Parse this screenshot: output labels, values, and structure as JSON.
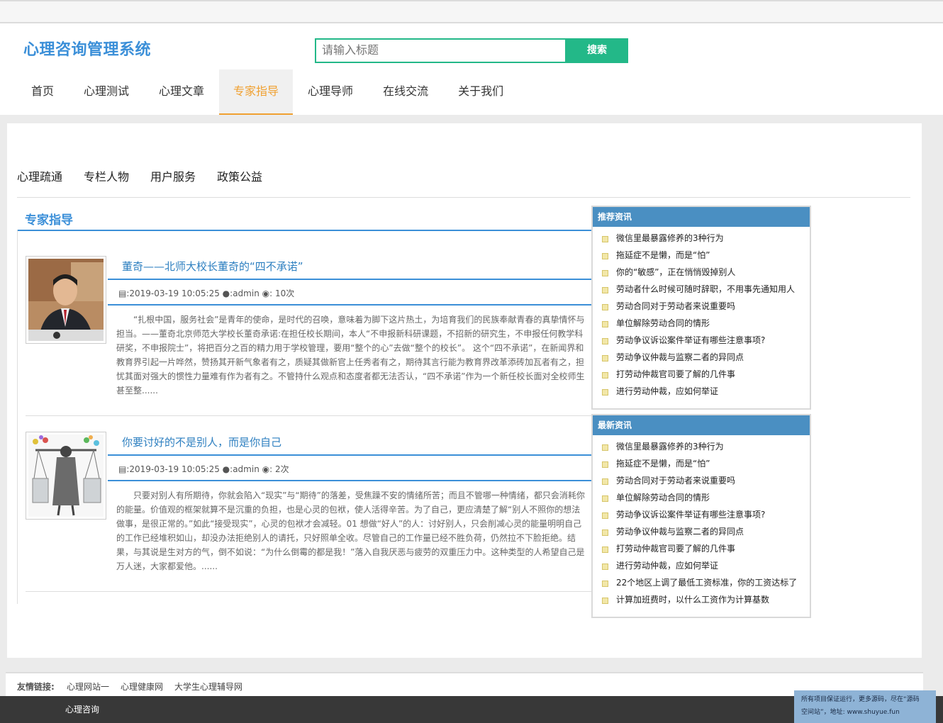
{
  "header": {
    "logo": "心理咨询管理系统",
    "search_placeholder": "请输入标题",
    "search_button": "搜索"
  },
  "nav": {
    "items": [
      "首页",
      "心理测试",
      "心理文章",
      "专家指导",
      "心理导师",
      "在线交流",
      "关于我们"
    ],
    "active": "专家指导"
  },
  "subnav": {
    "items": [
      "心理疏通",
      "专栏人物",
      "用户服务",
      "政策公益"
    ]
  },
  "main": {
    "column_title": "专家指导",
    "articles": [
      {
        "title": "董奇——北师大校长董奇的“四不承诺”",
        "date": ":2019-03-19 10:05:25",
        "author": ":admin",
        "views": ": 10次",
        "summary": "“扎根中国，服务社会”是青年的使命，是时代的召唤，意味着为脚下这片热土，为培育我们的民族奉献青春的真挚情怀与担当。——董奇北京师范大学校长董奇承诺:在担任校长期间，本人“不申报新科研课题，不招新的研究生，不申报任何教学科研奖，不申报院士”，将把百分之百的精力用于学校管理，要用“整个的心”去做“整个的校长”。  这个“四不承诺”，在新闻界和教育界引起一片哗然，赞扬其开新气象者有之，质疑其做新官上任秀者有之，期待其言行能为教育界改革添砖加瓦者有之，担忧其面对强大的惯性力量难有作为者有之。不管持什么观点和态度者都无法否认，“四不承诺”作为一个新任校长面对全校师生甚至整......"
      },
      {
        "title": "你要讨好的不是别人，而是你自己",
        "date": ":2019-03-19 10:05:25",
        "author": ":admin",
        "views": ": 2次",
        "summary": "只要对别人有所期待，你就会陷入“现实”与“期待”的落差，受焦躁不安的情绪所苦；而且不管哪一种情绪，都只会消耗你的能量。价值观的框架就算不是沉重的负担，也是心灵的包袱，使人活得辛苦。为了自己，更应清楚了解“别人不照你的想法做事，是很正常的。”如此“接受现实”，心灵的包袱才会减轻。01 想做“好人”的人：讨好别人，只会削减心灵的能量明明自己的工作已经堆积如山，却没办法拒绝别人的请托，只好照单全收。尽管自己的工作量已经不胜负荷，仍然拉不下脸拒绝。结果，与其说是生对方的气，倒不如说：“为什么倒霉的都是我！”落入自我厌恶与疲劳的双重压力中。这种类型的人希望自己是万人迷，大家都爱他。......"
      }
    ]
  },
  "sidebar": {
    "recommended": {
      "title": "推荐资讯",
      "items": [
        "微信里最暴露修养的3种行为",
        "拖延症不是懒，而是“怕”",
        "你的“敏感”，正在悄悄毁掉别人",
        "劳动者什么时候可随时辞职，不用事先通知用人",
        "劳动合同对于劳动者来说重要吗",
        "单位解除劳动合同的情形",
        "劳动争议诉讼案件举证有哪些注意事项?",
        "劳动争议仲裁与监察二者的异同点",
        "打劳动仲裁官司要了解的几件事",
        "进行劳动仲裁，应如何举证"
      ]
    },
    "latest": {
      "title": "最新资讯",
      "items": [
        "微信里最暴露修养的3种行为",
        "拖延症不是懒，而是“怕”",
        "劳动合同对于劳动者来说重要吗",
        "单位解除劳动合同的情形",
        "劳动争议诉讼案件举证有哪些注意事项?",
        "劳动争议仲裁与监察二者的异同点",
        "打劳动仲裁官司要了解的几件事",
        "进行劳动仲裁，应如何举证",
        "22个地区上调了最低工资标准，你的工资达标了",
        "计算加班费时，以什么工资作为计算基数"
      ]
    }
  },
  "links": {
    "label": "友情链接:",
    "items": [
      "心理网站一",
      "心理健康网",
      "大学生心理辅导网"
    ]
  },
  "footer": {
    "text": "心理咨询",
    "notice_line1": "所有项目保证运行，更多源码，尽在“源码",
    "notice_line2": "空间站”，地址: www.shuyue.fun"
  },
  "colors": {
    "accent_blue": "#3b8fd8",
    "search_green": "#23b888",
    "active_orange": "#f0a030",
    "sidebar_header": "#4a8fc2"
  },
  "icons": [
    "calendar-icon",
    "user-icon",
    "eye-icon",
    "list-bullet-icon"
  ]
}
